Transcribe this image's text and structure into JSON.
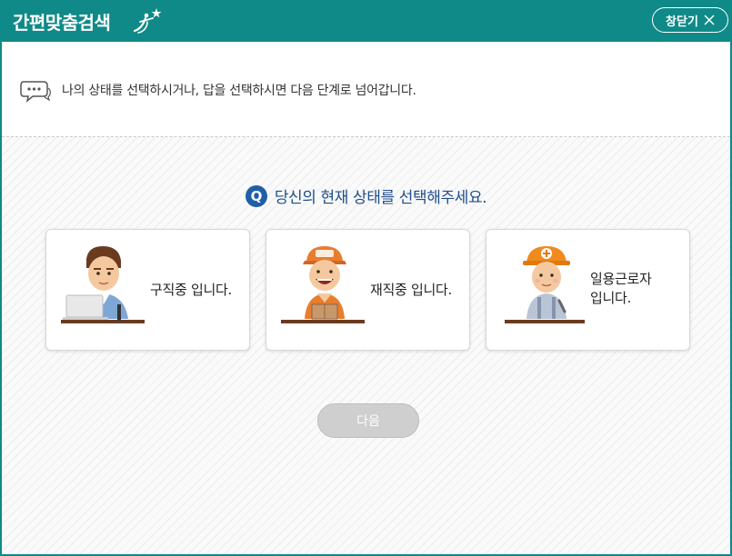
{
  "window": {
    "title": "간편맞춤검색",
    "close_label": "창닫기"
  },
  "notice": {
    "text": "나의 상태를 선택하시거나, 답을 선택하시면 다음 단계로 넘어갑니다."
  },
  "question": {
    "badge": "Q",
    "text": "당신의 현재 상태를 선택해주세요."
  },
  "options": [
    {
      "label": "구직중 입니다.",
      "icon": "job-seeker-icon"
    },
    {
      "label": "재직중 입니다.",
      "icon": "employed-worker-icon"
    },
    {
      "label_line1": "일용근로자",
      "label_line2": "입니다.",
      "icon": "day-laborer-icon"
    }
  ],
  "next_button": {
    "label": "다음"
  },
  "colors": {
    "brand": "#0f8a88",
    "question": "#1e4e8c",
    "q_badge": "#1e5fa8",
    "next_disabled": "#cfcfcf"
  }
}
